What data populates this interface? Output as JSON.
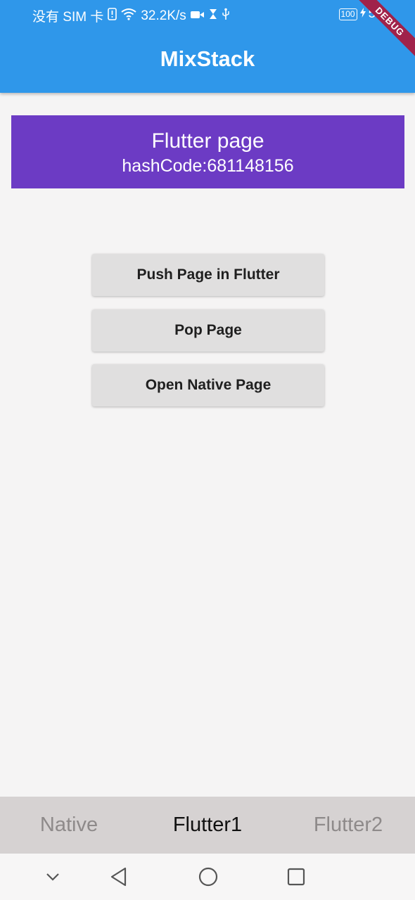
{
  "status_bar": {
    "carrier": "没有 SIM 卡",
    "speed": "32.2K/s",
    "battery": "100",
    "time": "5:2",
    "icons": [
      "sim-alert-icon",
      "wifi-icon",
      "video-icon",
      "hourglass-icon",
      "usb-icon",
      "charging-icon"
    ]
  },
  "debug_banner": "DEBUG",
  "app_bar": {
    "title": "MixStack",
    "color": "#2f97ea"
  },
  "page_card": {
    "title": "Flutter page",
    "hash_code": "hashCode:681148156",
    "color": "#6c3bc4"
  },
  "buttons": {
    "push": "Push Page in Flutter",
    "pop": "Pop Page",
    "open_native": "Open Native Page"
  },
  "tabs": [
    {
      "label": "Native",
      "selected": false
    },
    {
      "label": "Flutter1",
      "selected": true
    },
    {
      "label": "Flutter2",
      "selected": false
    }
  ],
  "nav_bar": {
    "icons": [
      "chevron-down-icon",
      "back-triangle-icon",
      "home-circle-icon",
      "recent-square-icon"
    ]
  }
}
